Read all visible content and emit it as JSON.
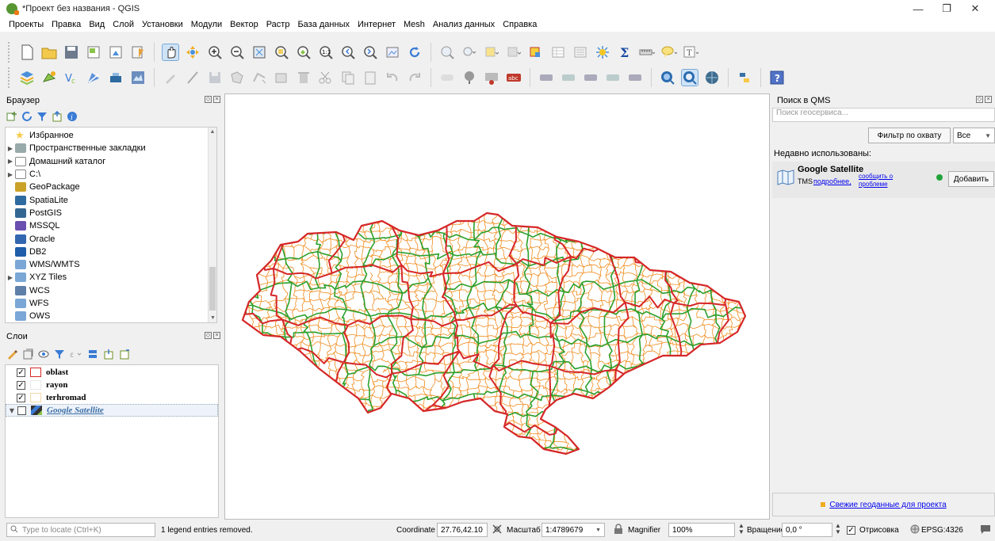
{
  "window": {
    "title": "*Проект без названия - QGIS",
    "minimize": "—",
    "restore": "❐",
    "close": "✕"
  },
  "menu": [
    "Проекты",
    "Правка",
    "Вид",
    "Слой",
    "Установки",
    "Модули",
    "Вектор",
    "Растр",
    "База данных",
    "Интернет",
    "Mesh",
    "Анализ данных",
    "Справка"
  ],
  "browser": {
    "title": "Браузер",
    "items": [
      {
        "label": "Избранное",
        "icon": "star-icon",
        "arrow": ""
      },
      {
        "label": "Пространственные закладки",
        "icon": "bookmark-icon",
        "arrow": "▶"
      },
      {
        "label": "Домашний каталог",
        "icon": "home-folder-icon",
        "arrow": "▶"
      },
      {
        "label": "C:\\",
        "icon": "folder-icon",
        "arrow": "▶"
      },
      {
        "label": "GeoPackage",
        "icon": "geopackage-icon",
        "arrow": ""
      },
      {
        "label": "SpatiaLite",
        "icon": "spatialite-icon",
        "arrow": ""
      },
      {
        "label": "PostGIS",
        "icon": "postgis-icon",
        "arrow": ""
      },
      {
        "label": "MSSQL",
        "icon": "mssql-icon",
        "arrow": ""
      },
      {
        "label": "Oracle",
        "icon": "oracle-icon",
        "arrow": ""
      },
      {
        "label": "DB2",
        "icon": "db2-icon",
        "arrow": ""
      },
      {
        "label": "WMS/WMTS",
        "icon": "wms-icon",
        "arrow": ""
      },
      {
        "label": "XYZ Tiles",
        "icon": "xyz-icon",
        "arrow": "▶"
      },
      {
        "label": "WCS",
        "icon": "wcs-icon",
        "arrow": ""
      },
      {
        "label": "WFS",
        "icon": "wfs-icon",
        "arrow": ""
      },
      {
        "label": "OWS",
        "icon": "ows-icon",
        "arrow": ""
      }
    ]
  },
  "layers": {
    "title": "Слои",
    "items": [
      {
        "name": "oblast",
        "checked": true,
        "swatch": "#d62728",
        "italic": false
      },
      {
        "name": "rayon",
        "checked": true,
        "swatch": "#e8e8e8",
        "italic": false
      },
      {
        "name": "terhromad",
        "checked": true,
        "swatch": "#f5d9a8",
        "italic": false
      },
      {
        "name": "Google Satellite",
        "checked": false,
        "swatch": "raster",
        "italic": true
      }
    ]
  },
  "qms": {
    "title": "Поиск в QMS",
    "search_placeholder": "Поиск геосервиса...",
    "filter_button": "Фильтр по охвату",
    "filter_select": "Все",
    "recent_label": "Недавно использованы:",
    "service_name": "Google Satellite",
    "service_type": "TMS",
    "link_more": "подробнее,",
    "link_report_1": "сообщить о",
    "link_report_2": "проблеме",
    "add_button": "Добавить",
    "footer_link": "Свежие геоданные для проекта"
  },
  "status": {
    "locate_placeholder": "Type to locate (Ctrl+K)",
    "message": "1 legend entries removed.",
    "coordinate_label": "Coordinate",
    "coordinate_value": "27.76,42.10",
    "scale_label": "Масштаб",
    "scale_value": "1:4789679",
    "magnifier_label": "Magnifier",
    "magnifier_value": "100%",
    "rotation_label": "Вращение",
    "rotation_value": "0,0 °",
    "render_label": "Отрисовка",
    "crs": "EPSG:4326"
  },
  "colors": {
    "oblast_border": "#d62728",
    "rayon_border": "#2ca02c",
    "terhromad_border": "#f08c1e"
  }
}
